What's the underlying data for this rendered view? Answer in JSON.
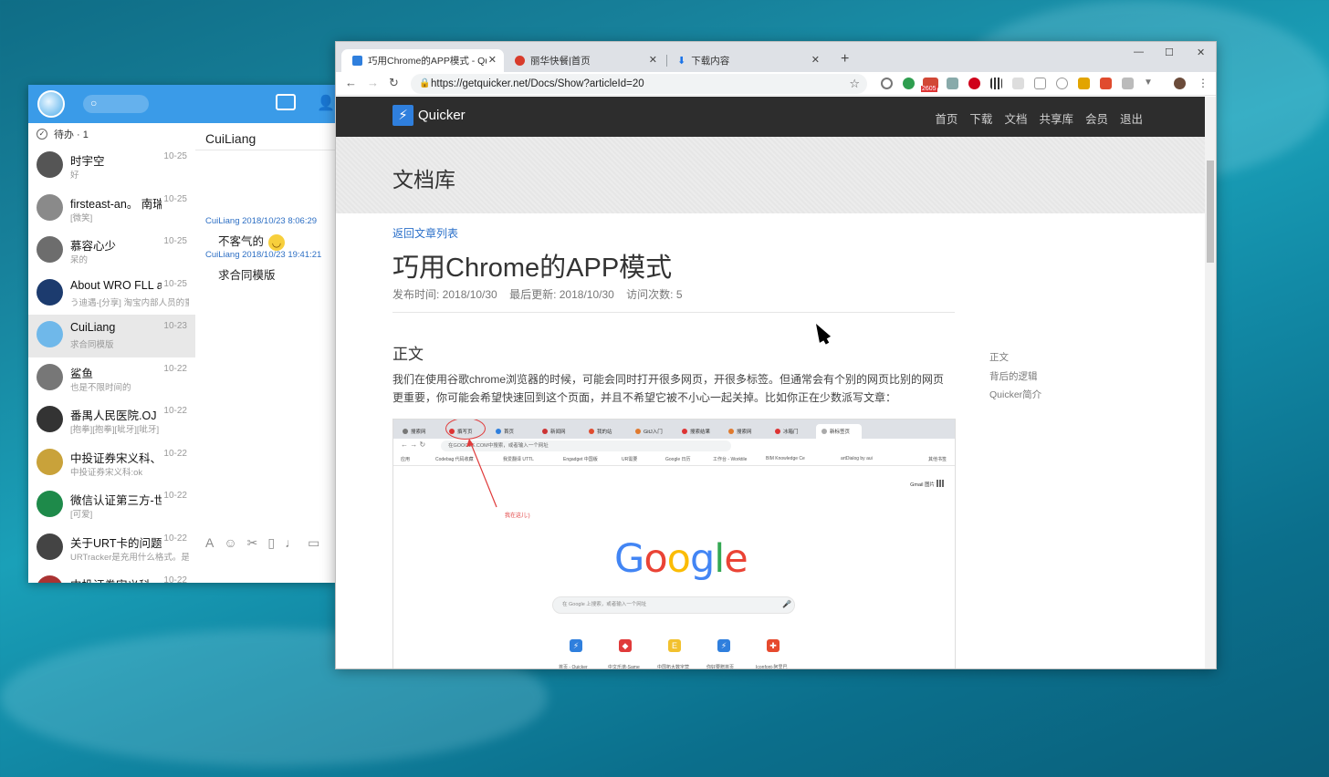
{
  "qq": {
    "search_placeholder": "Q",
    "todo_label": "待办 · 1",
    "conversations": [
      {
        "name": "时宇空",
        "time": "10-25",
        "preview": "好",
        "avatar_color": "#555"
      },
      {
        "name": "firsteast-an。 南瑞",
        "time": "10-25",
        "preview": "[微笑]",
        "avatar_color": "#8a8a8a"
      },
      {
        "name": "慕容心少",
        "time": "10-25",
        "preview": "呆的",
        "avatar_color": "#6d6d6d"
      },
      {
        "name": "About WRO FLL ar",
        "time": "10-25",
        "preview": "う迪遇-[分享] 淘宝内部人员的重",
        "avatar_color": "#1c3b6e"
      },
      {
        "name": "CuiLiang",
        "time": "10-23",
        "preview": "求合同模版",
        "avatar_color": "#6fb8ea"
      },
      {
        "name": "鲨鱼",
        "time": "10-22",
        "preview": "也是不限时间的",
        "avatar_color": "#777"
      },
      {
        "name": "番禺人民医院.OJ",
        "time": "10-22",
        "preview": "[抱拳][抱拳][呲牙][呲牙]",
        "avatar_color": "#333"
      },
      {
        "name": "中投证券宋义科、蓝",
        "time": "10-22",
        "preview": "中投证券宋义科:ok",
        "avatar_color": "#c9a23a"
      },
      {
        "name": "微信认证第三方-世纪",
        "time": "10-22",
        "preview": "[可爱]",
        "avatar_color": "#1e8a4a"
      },
      {
        "name": "关于URT卡的问题",
        "time": "10-22",
        "preview": "URTracker是充用什么格式。是",
        "avatar_color": "#444"
      },
      {
        "name": "中投证券宋义科",
        "time": "10-22",
        "preview": "",
        "avatar_color": "#a33"
      }
    ],
    "chat": {
      "title": "CuiLiang",
      "messages": [
        {
          "head": "CuiLiang 2018/10/23 8:06:29",
          "body": "不客气的"
        },
        {
          "head": "CuiLiang 2018/10/23 19:41:21",
          "body": "求合同模版"
        }
      ]
    }
  },
  "chrome": {
    "tabs": [
      {
        "label": "巧用Chrome的APP模式 - Quick",
        "favicon_color": "#2f7fdd"
      },
      {
        "label": "丽华快餐|首页",
        "favicon_color": "#d83b2b"
      },
      {
        "label": "下载内容",
        "favicon_color": "#1a73e8"
      }
    ],
    "url": "https://getquicker.net/Docs/Show?articleId=20",
    "ext_badge": "2605",
    "site": {
      "brand": "Quicker",
      "nav": [
        "首页",
        "下载",
        "文档",
        "共享库",
        "会员",
        "退出"
      ],
      "jumbo_title": "文档库",
      "back_link": "返回文章列表",
      "article_title": "巧用Chrome的APP模式",
      "meta": {
        "published": "发布时间: 2018/10/30",
        "updated": "最后更新: 2018/10/30",
        "visits": "访问次数: 5"
      },
      "section_title": "正文",
      "paragraph": "我们在使用谷歌chrome浏览器的时候，可能会同时打开很多网页，开很多标签。但通常会有个别的网页比别的网页更重要，你可能会希望快速回到这个页面，并且不希望它被不小心一起关掉。比如你正在少数派写文章：",
      "toc": [
        "正文",
        "背后的逻辑",
        "Quicker简介"
      ]
    },
    "screenshot": {
      "tabs": [
        "搜索网",
        "撰写页",
        "首页",
        "新闻网",
        "我的站",
        "GitJ入门",
        "搜索结果",
        "搜索网",
        "冰箱门",
        "新标签页"
      ],
      "omni_text": "在GOOGLE.COM中搜索，或者输入一个网址",
      "bookmarks": [
        "应用",
        "Codebag 代码收藏",
        "我爱翻译 UTTL",
        "Engadget 中国版",
        "UR需要",
        "Google 日历",
        "工作台 - Worktile",
        "BIM Knowledge Ce",
        "artDialog by aui",
        "其他书签"
      ],
      "top_links": "Gmail  图片",
      "callout": "我在这儿:)",
      "google": [
        "G",
        "o",
        "o",
        "g",
        "l",
        "e"
      ],
      "google_colors": [
        "#4285f4",
        "#ea4335",
        "#fbbc05",
        "#4285f4",
        "#34a853",
        "#ea4335"
      ],
      "search_placeholder": "在 Google 上搜索，或者输入一个网址",
      "tiles": [
        {
          "label": "首页 - Quicker",
          "color": "#2f7fdd",
          "glyph": "⚡"
        },
        {
          "label": "中文乐谱-Same",
          "color": "#e03a3a",
          "glyph": "◆"
        },
        {
          "label": "中国拓大数字营",
          "color": "#f2c12e",
          "glyph": "E"
        },
        {
          "label": "你好要赠首页",
          "color": "#2f7fdd",
          "glyph": "⚡"
        },
        {
          "label": "Iconfont-阿里巴",
          "color": "#e64a2e",
          "glyph": "✚"
        }
      ]
    }
  }
}
